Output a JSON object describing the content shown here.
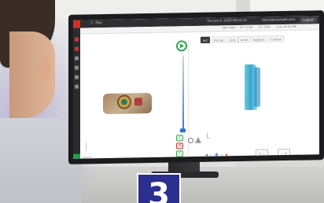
{
  "app": {
    "title": "3 - Plan",
    "datetime": "Thu Jun 4, 2020 08:52:12",
    "user": "demo@example.com",
    "logout_label": "Logout"
  },
  "subbar": {
    "stats": [
      "NA: 0000",
      "LT: 17.00",
      "FL: 0.00",
      "CLA: 00.00 ME"
    ]
  },
  "tabs": [
    {
      "label": "Init",
      "active": true
    },
    {
      "label": "Frontal"
    },
    {
      "label": "Side"
    },
    {
      "label": "Axial"
    },
    {
      "label": "Sagittal"
    },
    {
      "label": "Coronal"
    }
  ],
  "nav": {
    "prev_label": "< ...",
    "next_label": "... >"
  },
  "playback": {
    "slider_level": 1.0
  },
  "colors": {
    "accent": "#d92b2b",
    "play": "#2ea84a",
    "slider": "#2e6fd1",
    "right_model": "#35a7cf",
    "badge_bg": "#2b2f8e"
  },
  "badge": {
    "number": "3"
  },
  "icons": {
    "play": "play-icon",
    "check": "check-icon",
    "close": "close-icon",
    "arrows": "transform-arrows-icon"
  }
}
